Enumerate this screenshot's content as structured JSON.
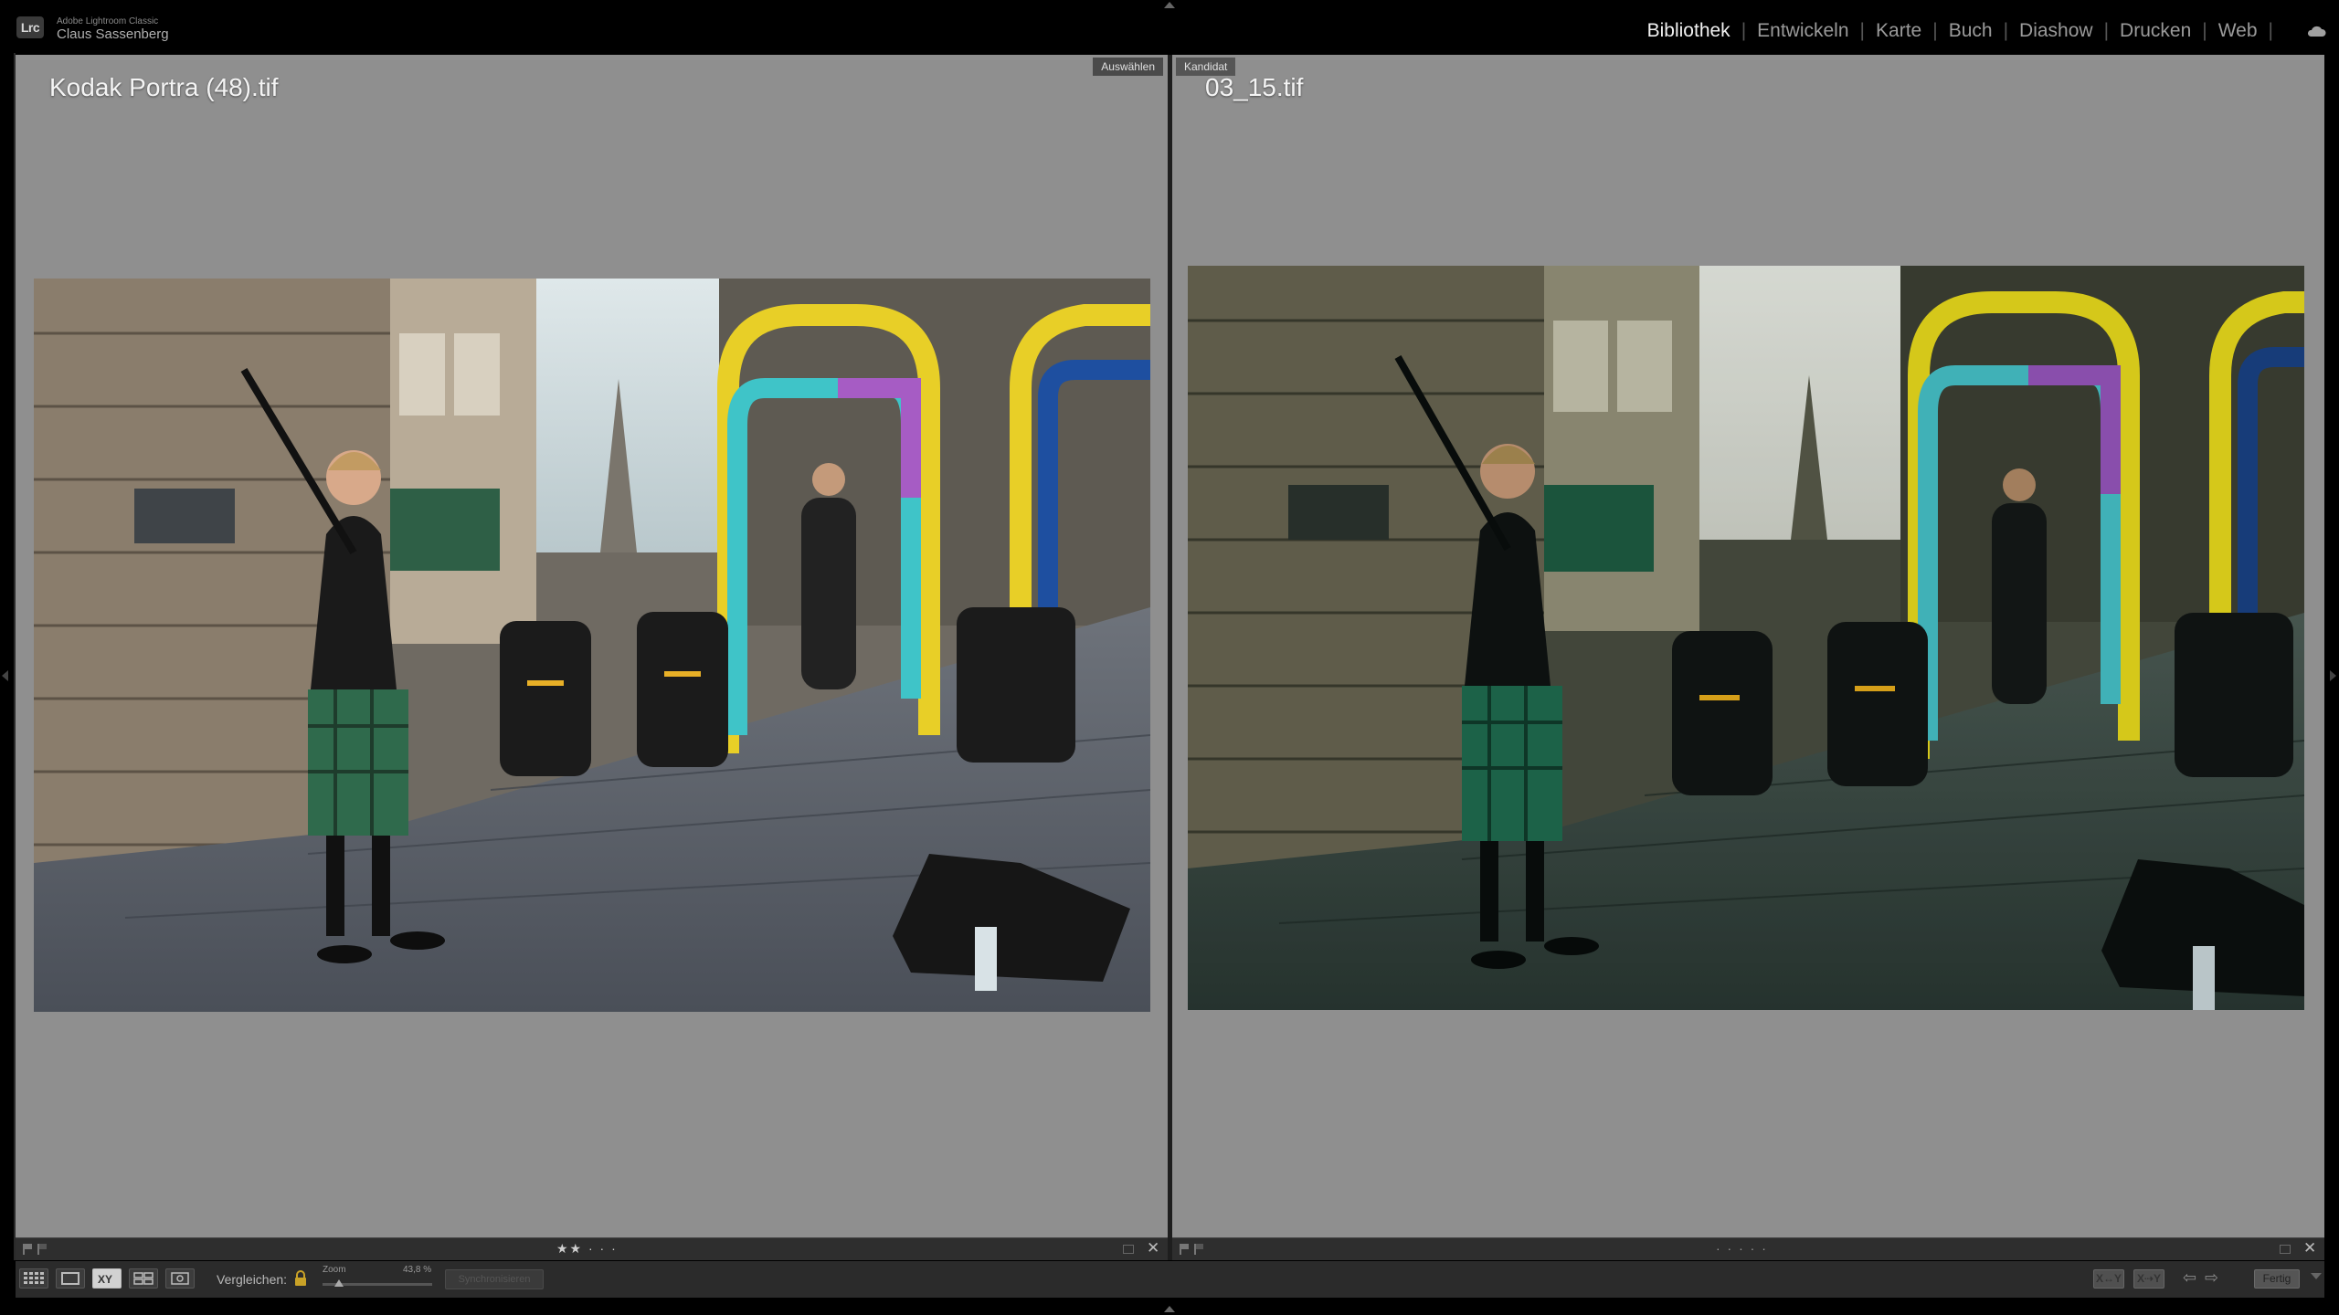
{
  "app": {
    "badge": "Lrc",
    "name": "Adobe Lightroom Classic",
    "user": "Claus Sassenberg"
  },
  "modules": [
    {
      "label": "Bibliothek",
      "active": true
    },
    {
      "label": "Entwickeln",
      "active": false
    },
    {
      "label": "Karte",
      "active": false
    },
    {
      "label": "Buch",
      "active": false
    },
    {
      "label": "Diashow",
      "active": false
    },
    {
      "label": "Drucken",
      "active": false
    },
    {
      "label": "Web",
      "active": false
    }
  ],
  "cloud_icon": "cloud-icon",
  "compare": {
    "select": {
      "tag": "Auswählen",
      "filename": "Kodak Portra (48).tif",
      "rating": "★★ · · ·"
    },
    "candidate": {
      "tag": "Kandidat",
      "filename": "03_15.tif",
      "rating": "· · · · ·"
    }
  },
  "toolbar": {
    "compare_label": "Vergleichen:",
    "zoom_label": "Zoom",
    "zoom_value": "43,8 %",
    "zoom_fraction": 0.15,
    "sync_label": "Synchronisieren",
    "swap_label": "X↔Y",
    "make_select_label": "X⇢Y",
    "done_label": "Fertig"
  },
  "colors": {
    "panel_bg": "#8f8f8f",
    "active_module": "#f2f2f2",
    "inactive_module": "#9a9a9a"
  }
}
